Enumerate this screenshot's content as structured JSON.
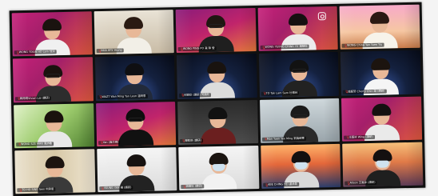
{
  "window": {
    "title": ""
  },
  "participants": [
    {
      "name": "WONG YIXAN HO Lam 佳潔",
      "bg": "bg-pink",
      "hair": "#1a130f",
      "shirt": "#f0f0f0",
      "extra": ""
    },
    {
      "name": "NGA HFS Yeung",
      "bg": "bg-room",
      "hair": "#2a1a12",
      "shirt": "#f2efe7",
      "extra": ""
    },
    {
      "name": "WONG PING PO 黃 陳 瑩",
      "bg": "bg-pink2",
      "hair": "#201712",
      "shirt": "#1f1f1f",
      "extra": "glasses"
    },
    {
      "name": "WONG YEUNG CHING YU 楊靜榆",
      "bg": "bg-pink",
      "hair": "#151010",
      "shirt": "#ececec",
      "extra": "ig"
    },
    {
      "name": "WONG Ching Yan Yuen Yiu",
      "bg": "bg-cartoon",
      "hair": "#2a1812",
      "shirt": "#f7f3ea",
      "extra": ""
    },
    {
      "name": "賴雨晴Vivian Lai (讀研)",
      "bg": "bg-pink",
      "hair": "#1b120e",
      "shirt": "#2d2d2d",
      "extra": "glasses"
    },
    {
      "name": "WAZT Wan Ming Yan Leon 溫明恩",
      "bg": "bg-space",
      "hair": "#0f0f12",
      "shirt": "#222a3a",
      "extra": ""
    },
    {
      "name": "何穎欣 (讀研) 何穎欣",
      "bg": "bg-space",
      "hair": "#19130f",
      "shirt": "#dcdcdc",
      "extra": ""
    },
    {
      "name": "TO Tak Lam Sam 杜德林",
      "bg": "bg-space",
      "hair": "#121212",
      "shirt": "#222",
      "extra": "glasses"
    },
    {
      "name": "錢嘉慧 Cherry Chin 錢 (讀研)",
      "bg": "bg-space",
      "hair": "#1c140f",
      "shirt": "#f5f5f5",
      "extra": ""
    },
    {
      "name": "WONG SZE MAN 黃詩敏",
      "bg": "bg-green",
      "hair": "#1a120d",
      "shirt": "#e9e9e9",
      "extra": ""
    },
    {
      "name": "Yan (黃芯晴)",
      "bg": "bg-pink2",
      "hair": "#0e0e0e",
      "shirt": "#111",
      "extra": "glasses"
    },
    {
      "name": "陳凱琪 (讀研)",
      "bg": "bg-dark",
      "hair": "#111",
      "shirt": "#6b1f1f",
      "extra": ""
    },
    {
      "name": "Man Yuen Yee Ming 劉黃綺雯",
      "bg": "bg-window",
      "hair": "#1a1a1a",
      "shirt": "#2a2a2a",
      "extra": "glasses"
    },
    {
      "name": "王嘉詠 Wing (讀研)",
      "bg": "bg-pink",
      "hair": "#151010",
      "shirt": "#eaeaea",
      "extra": ""
    },
    {
      "name": "TO HO SING Seni 何承星",
      "bg": "bg-curtain",
      "hair": "#1c140f",
      "shirt": "#3a3a3a",
      "extra": ""
    },
    {
      "name": "YEUNG YAN 楊 (讀研)",
      "bg": "bg-white",
      "hair": "#171210",
      "shirt": "#222",
      "extra": ""
    },
    {
      "name": "姚靜怡 (讀研)",
      "bg": "bg-white",
      "hair": "#1a1410",
      "shirt": "#f2f2f2",
      "extra": "mask"
    },
    {
      "name": "ABE CHING HEI 盧承熙",
      "bg": "bg-bridge",
      "hair": "#141010",
      "shirt": "#d9d9d9",
      "extra": "mask"
    },
    {
      "name": "Alison 王嘉詠 (讀研)",
      "bg": "bg-sunset",
      "hair": "#141010",
      "shirt": "#1f1f1f",
      "extra": "mask"
    }
  ]
}
